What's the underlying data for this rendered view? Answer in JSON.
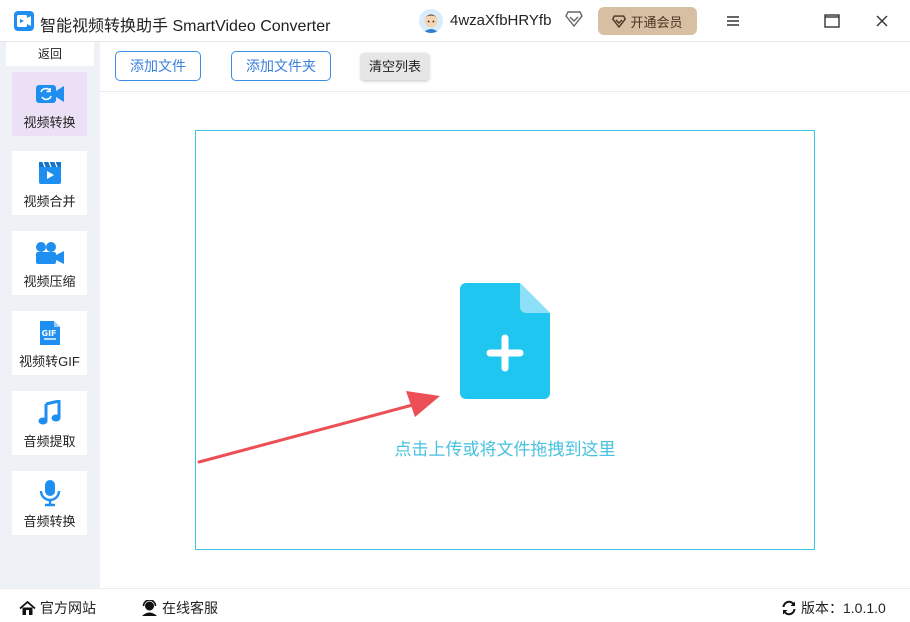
{
  "titlebar": {
    "app_title": "智能视频转换助手 SmartVideo Converter",
    "username": "4wzaXfbHRYfb",
    "vip_label": "开通会员",
    "icons": [
      "app-logo-icon",
      "avatar",
      "diamond-icon",
      "menu-icon",
      "maximize-icon",
      "close-icon"
    ]
  },
  "sidebar": {
    "back_label": "返回",
    "items": [
      {
        "label": "视频转换",
        "icon": "video-convert-icon",
        "active": true
      },
      {
        "label": "视频合并",
        "icon": "video-merge-icon",
        "active": false
      },
      {
        "label": "视频压缩",
        "icon": "video-compress-icon",
        "active": false
      },
      {
        "label": "视频转GIF",
        "icon": "gif-icon",
        "active": false
      },
      {
        "label": "音频提取",
        "icon": "music-note-icon",
        "active": false
      },
      {
        "label": "音频转换",
        "icon": "microphone-icon",
        "active": false
      }
    ]
  },
  "toolbar": {
    "add_file_label": "添加文件",
    "add_folder_label": "添加文件夹",
    "clear_list_label": "清空列表"
  },
  "main": {
    "drop_text": "点击上传或将文件拖拽到这里"
  },
  "statusbar": {
    "website_label": "官方网站",
    "service_label": "在线客服",
    "version_label": "版本：1.0.1.0"
  },
  "colors": {
    "accent": "#1e8ff0",
    "drop_border": "#35c7e3",
    "file_icon": "#1fc6f0",
    "arrow": "#ec4f55",
    "vip_bg": "#d7bfa4",
    "active_nav": "#ece0f6"
  }
}
